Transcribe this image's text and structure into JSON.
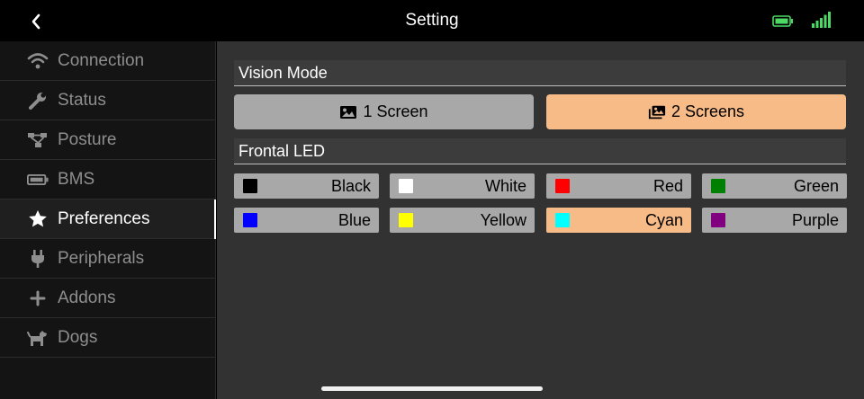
{
  "header": {
    "title": "Setting"
  },
  "sidebar": {
    "items": [
      {
        "label": "Connection",
        "icon": "wifi-icon"
      },
      {
        "label": "Status",
        "icon": "wrench-icon"
      },
      {
        "label": "Posture",
        "icon": "posture-icon"
      },
      {
        "label": "BMS",
        "icon": "battery-icon"
      },
      {
        "label": "Preferences",
        "icon": "star-icon",
        "active": true
      },
      {
        "label": "Peripherals",
        "icon": "plug-icon"
      },
      {
        "label": "Addons",
        "icon": "plus-icon"
      },
      {
        "label": "Dogs",
        "icon": "dog-icon"
      }
    ]
  },
  "vision_mode": {
    "title": "Vision Mode",
    "options": [
      {
        "label": "1 Screen",
        "icon": "image-icon",
        "selected": false
      },
      {
        "label": "2 Screens",
        "icon": "images-icon",
        "selected": true
      }
    ]
  },
  "frontal_led": {
    "title": "Frontal LED",
    "options": [
      {
        "label": "Black",
        "color": "#000000",
        "selected": false
      },
      {
        "label": "White",
        "color": "#ffffff",
        "selected": false
      },
      {
        "label": "Red",
        "color": "#ff0000",
        "selected": false
      },
      {
        "label": "Green",
        "color": "#008000",
        "selected": false
      },
      {
        "label": "Blue",
        "color": "#0000ff",
        "selected": false
      },
      {
        "label": "Yellow",
        "color": "#ffff00",
        "selected": false
      },
      {
        "label": "Cyan",
        "color": "#00ffff",
        "selected": true
      },
      {
        "label": "Purple",
        "color": "#800080",
        "selected": false
      }
    ]
  },
  "colors": {
    "accent": "#f7bb88",
    "button_gray": "#a8a8a8",
    "status_green": "#4cd964"
  }
}
